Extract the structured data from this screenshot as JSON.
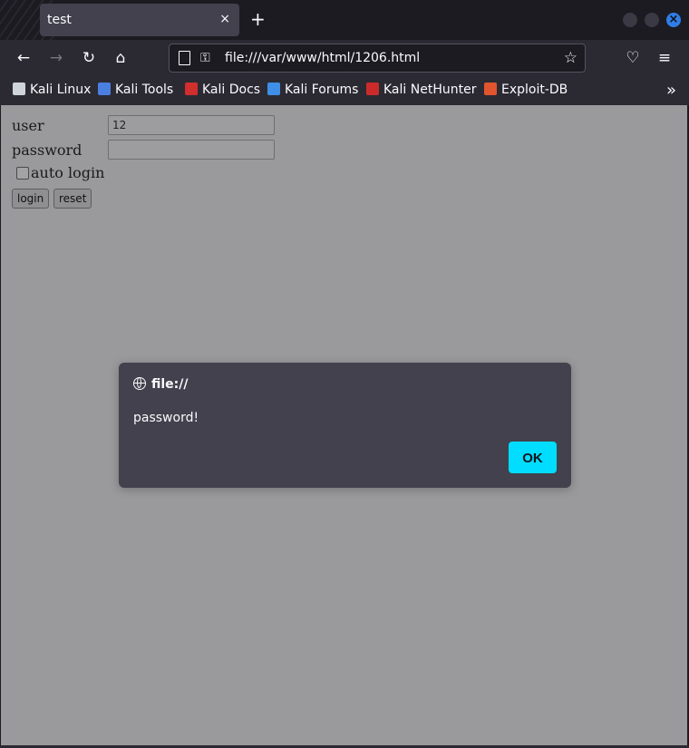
{
  "tab": {
    "title": "test",
    "close": "×",
    "new_tab": "+"
  },
  "window_controls": {
    "close": "×"
  },
  "nav": {
    "back": "←",
    "forward": "→",
    "reload": "↻",
    "home": "⌂",
    "url": "file:///var/www/html/1206.html",
    "bookmark_star": "☆",
    "pocket": "♡",
    "menu": "≡"
  },
  "bookmarks": {
    "items": [
      {
        "label": "Kali Linux",
        "color": "#cfd3da"
      },
      {
        "label": "Kali Tools",
        "color": "#4a7ee0"
      },
      {
        "label": "Kali Docs",
        "color": "#d12e2e"
      },
      {
        "label": "Kali Forums",
        "color": "#3f8ee8"
      },
      {
        "label": "Kali NetHunter",
        "color": "#cc2b2b"
      },
      {
        "label": "Exploit-DB",
        "color": "#e0552d"
      }
    ],
    "more": "»"
  },
  "form": {
    "user_label": "user",
    "user_value": "12",
    "password_label": "password",
    "password_value": "",
    "auto_login_label": "auto login",
    "login_button": "login",
    "reset_button": "reset"
  },
  "dialog": {
    "origin": "file://",
    "message": "password!",
    "ok_button": "OK"
  }
}
